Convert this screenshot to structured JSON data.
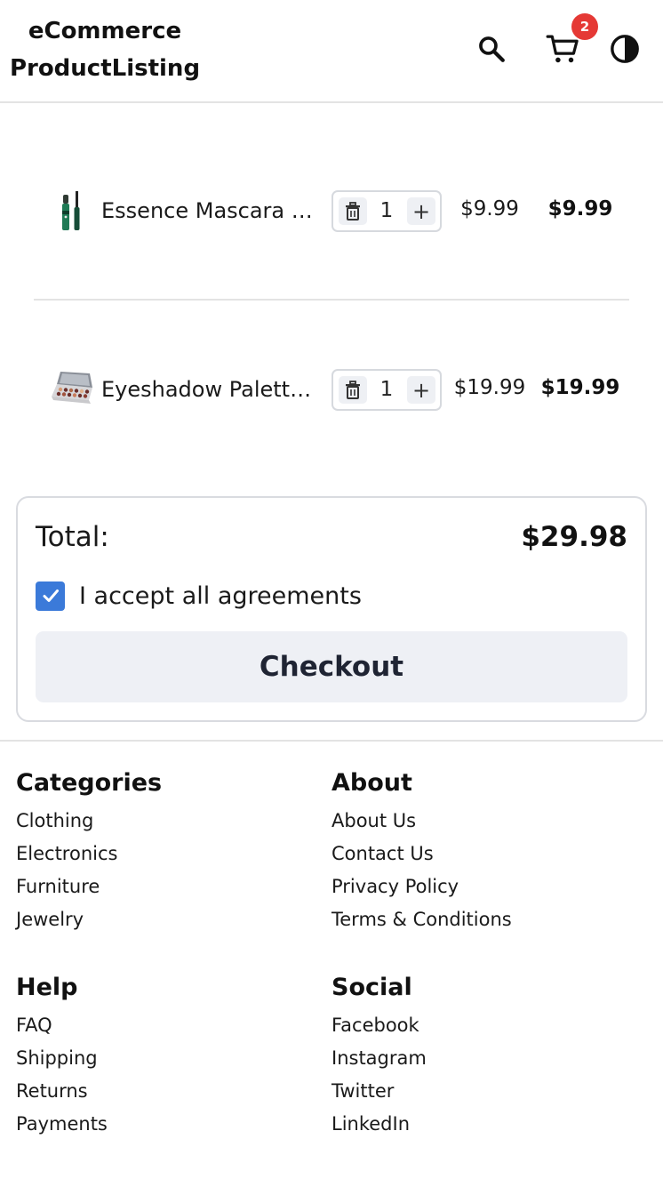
{
  "header": {
    "brand_line1": "eCommerce",
    "brand_line2": "ProductListing",
    "cart_count": "2",
    "icons": {
      "search": "search-icon",
      "cart": "cart-icon",
      "theme": "theme-toggle-icon"
    }
  },
  "cart": {
    "items": [
      {
        "name": "Essence Mascara Lash Princess",
        "quantity": "1",
        "unit_price": "$9.99",
        "line_total": "$9.99",
        "thumbnail": "mascara-thumbnail"
      },
      {
        "name": "Eyeshadow Palette with Mirror",
        "quantity": "1",
        "unit_price": "$19.99",
        "line_total": "$19.99",
        "thumbnail": "eyeshadow-palette-thumbnail"
      }
    ],
    "quantity_controls": {
      "delete_icon": "trash-icon",
      "increment_label": "+"
    }
  },
  "summary": {
    "total_label": "Total:",
    "total_value": "$29.98",
    "agreement_label": "I accept all agreements",
    "agreement_checked": true,
    "checkout_label": "Checkout"
  },
  "footer": {
    "columns": [
      {
        "title": "Categories",
        "links": [
          "Clothing",
          "Electronics",
          "Furniture",
          "Jewelry"
        ]
      },
      {
        "title": "About",
        "links": [
          "About Us",
          "Contact Us",
          "Privacy Policy",
          "Terms & Conditions"
        ]
      },
      {
        "title": "Help",
        "links": [
          "FAQ",
          "Shipping",
          "Returns",
          "Payments"
        ]
      },
      {
        "title": "Social",
        "links": [
          "Facebook",
          "Instagram",
          "Twitter",
          "LinkedIn"
        ]
      }
    ]
  },
  "colors": {
    "badge": "#e53935",
    "checkbox": "#3b7ad9",
    "checkout_bg": "#eef0f5",
    "border": "#d9dbe0"
  }
}
